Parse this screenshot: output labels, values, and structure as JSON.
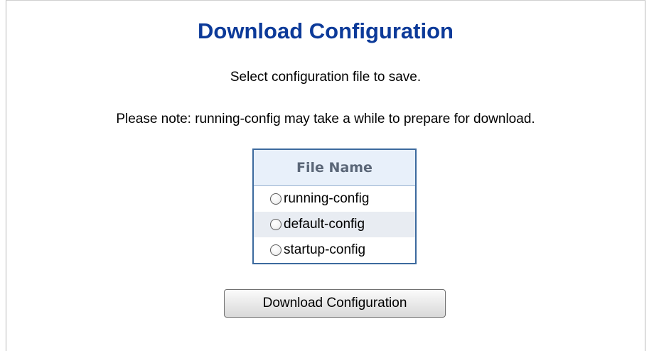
{
  "page": {
    "title": "Download Configuration",
    "subtitle": "Select configuration file to save.",
    "note": "Please note: running-config may take a while to prepare for download."
  },
  "file_table": {
    "header": "File Name",
    "files": [
      {
        "label": "running-config",
        "selected": false
      },
      {
        "label": "default-config",
        "selected": false
      },
      {
        "label": "startup-config",
        "selected": false
      }
    ]
  },
  "actions": {
    "download_label": "Download Configuration"
  },
  "colors": {
    "title": "#0c3a99",
    "table_border": "#3c6a9e",
    "table_header_bg": "#e8f0fa",
    "row_alt_bg": "#e8ecf2"
  }
}
